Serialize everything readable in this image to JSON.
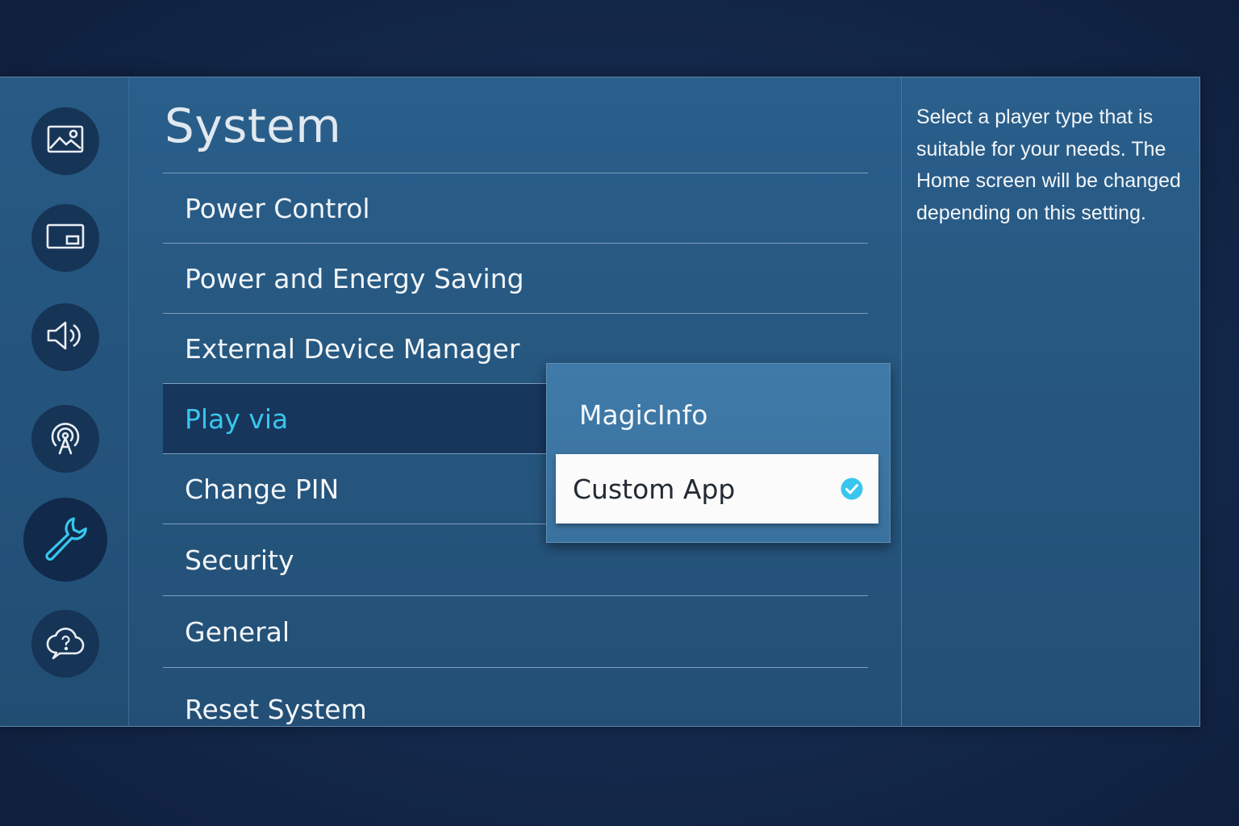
{
  "page": {
    "title": "System"
  },
  "sidebar": {
    "items": [
      {
        "name": "picture",
        "icon": "picture-icon"
      },
      {
        "name": "screen",
        "icon": "picture-in-picture-icon"
      },
      {
        "name": "sound",
        "icon": "speaker-icon"
      },
      {
        "name": "network",
        "icon": "broadcast-antenna-icon"
      },
      {
        "name": "system",
        "icon": "wrench-icon",
        "active": true
      },
      {
        "name": "support",
        "icon": "help-cloud-icon"
      }
    ]
  },
  "menu": {
    "items": [
      {
        "label": "Power Control"
      },
      {
        "label": "Power and Energy Saving"
      },
      {
        "label": "External Device Manager"
      },
      {
        "label": "Play via",
        "selected": true
      },
      {
        "label": "Change PIN"
      },
      {
        "label": "Security"
      },
      {
        "label": "General"
      },
      {
        "label": "Reset System"
      }
    ]
  },
  "popup": {
    "options": [
      {
        "label": "MagicInfo",
        "checked": false
      },
      {
        "label": "Custom App",
        "checked": true
      }
    ]
  },
  "help": {
    "text": "Select a player type that is suitable for your needs. The Home screen will be changed depending on this setting."
  },
  "colors": {
    "accent": "#38c6ee",
    "check": "#38c6ee",
    "selected_row": "#17365c",
    "panel": "#26577f"
  }
}
